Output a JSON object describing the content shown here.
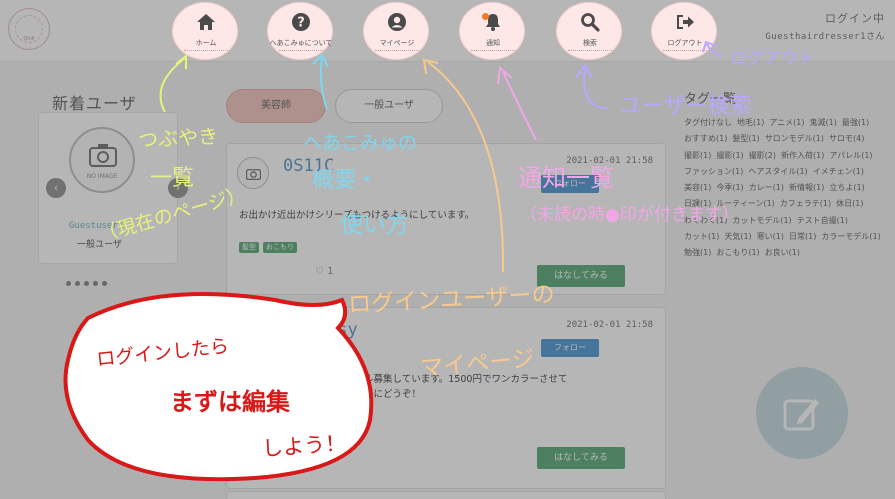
{
  "header": {
    "logo_text": "Qh#",
    "login_status": "ログイン中",
    "login_user": "Guesthairdresser1さん",
    "nav": [
      {
        "label": "ホーム",
        "icon": "home-icon"
      },
      {
        "label": "へあこみゅについて",
        "icon": "question-icon"
      },
      {
        "label": "マイページ",
        "icon": "user-icon"
      },
      {
        "label": "通知",
        "icon": "bell-icon"
      },
      {
        "label": "検索",
        "icon": "search-icon"
      },
      {
        "label": "ログアウト",
        "icon": "logout-icon"
      }
    ],
    "notification_dot_color": "#ef7a2f"
  },
  "sidebar": {
    "title": "新着ユーザ",
    "card": {
      "image_text": "NO IMAGE",
      "name": "Guestuser1",
      "role": "一般ユーザ"
    },
    "prev": "‹",
    "next": "›"
  },
  "tabs": [
    {
      "label": "美容師"
    },
    {
      "label": "一般ユーザ"
    }
  ],
  "posts": [
    {
      "user": "0S11C",
      "date": "2021-02-01 21:58",
      "follow_label": "フォロー",
      "text": "お出かけ近出かけシリーズもつけるようにしています。",
      "tags": [
        "髪型",
        "おこもり"
      ],
      "likes": "1",
      "talk_label": "はなしてみる"
    },
    {
      "user": "ysy",
      "date": "2021-02-01 21:58",
      "follow_label": "フォロー",
      "text": "モデル募集しています。1500円でワンカラーさせて",
      "text2": "お気軽にどうぞ！",
      "talk_label": "はなしてみる"
    }
  ],
  "tagcloud": {
    "title": "タグ一覧",
    "tags": [
      "タグ付けなし",
      "地毛(1)",
      "アニメ(1)",
      "鬼滅(1)",
      "最強(1)",
      "おすすめ(1)",
      "髪型(1)",
      "サロンモデル(1)",
      "サロモ(4)",
      "撮影(1)",
      "撮影(1)",
      "撮影(2)",
      "新作入荷(1)",
      "アパレル(1)",
      "ファッション(1)",
      "ヘアスタイル(1)",
      "イメチェン(1)",
      "美容(1)",
      "今季(1)",
      "カレー(1)",
      "新情報(1)",
      "立ちよ(1)",
      "日課(1)",
      "ルーティーン(1)",
      "カフェラテ(1)",
      "休日(1)",
      "わくわく(1)",
      "カットモデル(1)",
      "テスト自撮(1)",
      "カット(1)",
      "天気(1)",
      "寒い(1)",
      "日常(1)",
      "カラーモデル(1)",
      "勉強(1)",
      "おこもり(1)",
      "お良い(1)"
    ]
  },
  "annotations": {
    "home": [
      "つぶやき",
      "一覧",
      "（現在のページ）"
    ],
    "about": [
      "へあこみゅの",
      "概要・",
      "使い方"
    ],
    "mypage": [
      "ログインユーザーの",
      "マイページ"
    ],
    "notify": [
      "通知一覧",
      "（未読の時●印が付きます）"
    ],
    "search": "ユーザー検索",
    "logout": "ログアウト",
    "bubble": [
      "ログインしたら",
      "まずは編集",
      "しよう！"
    ]
  }
}
